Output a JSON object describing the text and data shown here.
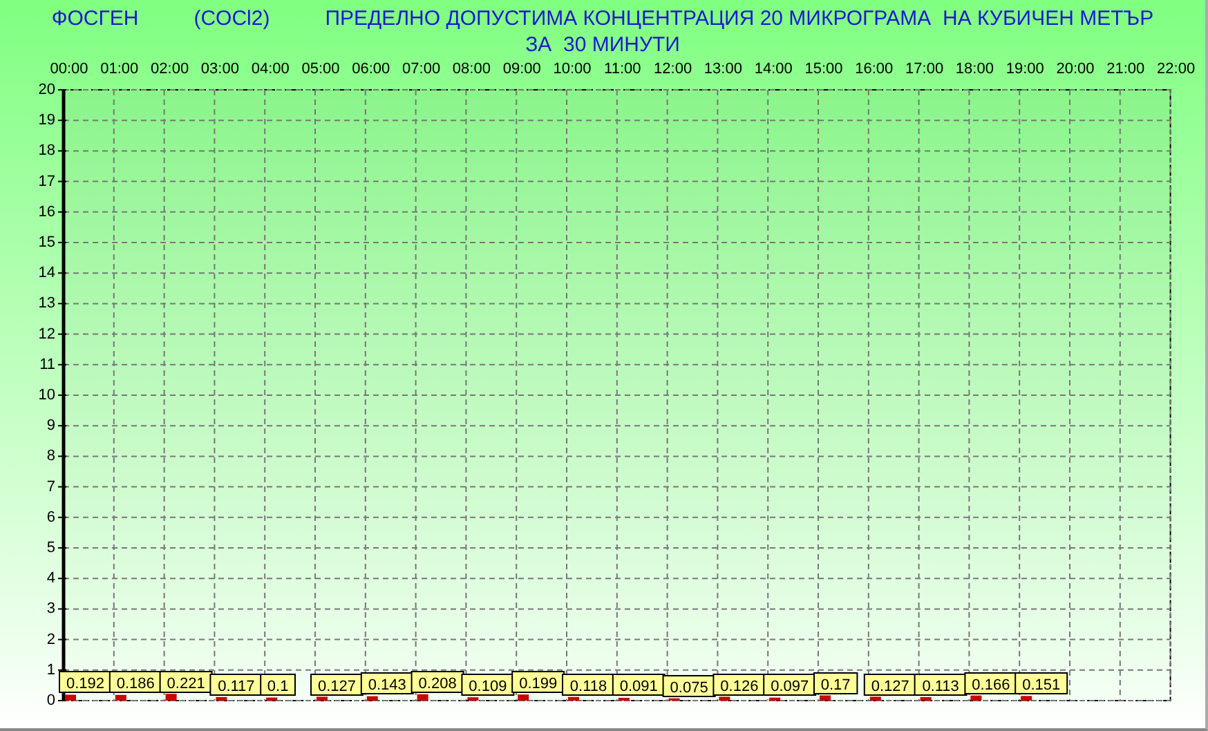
{
  "title": {
    "substance": "ФОСГЕН",
    "formula": "(COCl2)",
    "limit": "ПРЕДЕЛНО ДОПУСТИМА КОНЦЕНТРАЦИЯ 20 МИКРОГРАМА  НА КУБИЧЕН МЕТЪР",
    "period": "ЗА  30 МИНУТИ"
  },
  "chart": {
    "chart_data": {
      "type": "bar",
      "categories": [
        "00:00",
        "01:00",
        "02:00",
        "03:00",
        "04:00",
        "05:00",
        "06:00",
        "07:00",
        "08:00",
        "09:00",
        "10:00",
        "11:00",
        "12:00",
        "13:00",
        "14:00",
        "15:00",
        "16:00",
        "17:00",
        "18:00",
        "19:00",
        "20:00",
        "21:00",
        "22:00"
      ],
      "series": [
        {
          "color": "#cc0000",
          "values": [
            0.192,
            0.186,
            0.221,
            0.117,
            0.1,
            0.127,
            0.143,
            0.208,
            0.109,
            0.199,
            0.118,
            0.091,
            0.075,
            0.126,
            0.097,
            0.17,
            0.127,
            0.113,
            0.166,
            0.151,
            null,
            null,
            null
          ]
        }
      ],
      "value_labels": [
        "0.192",
        "0.186",
        "0.221",
        "0.117",
        "0.1",
        "0.127",
        "0.143",
        "0.208",
        "0.109",
        "0.199",
        "0.118",
        "0.091",
        "0.075",
        "0.126",
        "0.097",
        "0.17",
        "0.127",
        "0.113",
        "0.166",
        "0.151",
        null,
        null,
        null
      ],
      "grid": true,
      "ylim": [
        0,
        20
      ],
      "yticks": [
        0,
        1,
        2,
        3,
        4,
        5,
        6,
        7,
        8,
        9,
        10,
        11,
        12,
        13,
        14,
        15,
        16,
        17,
        18,
        19,
        20
      ]
    }
  }
}
